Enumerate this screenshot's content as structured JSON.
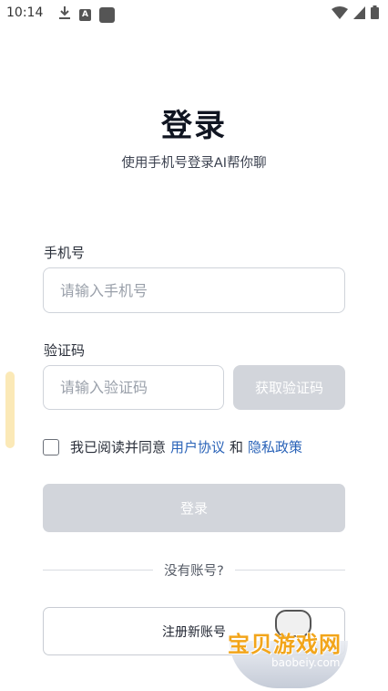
{
  "status_bar": {
    "time": "10:14",
    "a_badge": "A"
  },
  "header": {
    "title": "登录",
    "subtitle": "使用手机号登录AI帮你聊"
  },
  "phone": {
    "label": "手机号",
    "placeholder": "请输入手机号",
    "value": ""
  },
  "code": {
    "label": "验证码",
    "placeholder": "请输入验证码",
    "value": "",
    "button_label": "获取验证码"
  },
  "agreement": {
    "prefix": "我已阅读并同意",
    "user_agreement": "用户协议",
    "conjunction": "和",
    "privacy_policy": "隐私政策",
    "checked": false
  },
  "login": {
    "button_label": "登录"
  },
  "divider": {
    "text": "没有账号?"
  },
  "register": {
    "button_label": "注册新账号"
  },
  "watermark": {
    "text": "宝贝游戏网",
    "url": "baobeiy.com"
  },
  "colors": {
    "link": "#2a63b8",
    "disabled_button": "#d2d5db",
    "title": "#101521",
    "watermark": "#f2a51a"
  }
}
